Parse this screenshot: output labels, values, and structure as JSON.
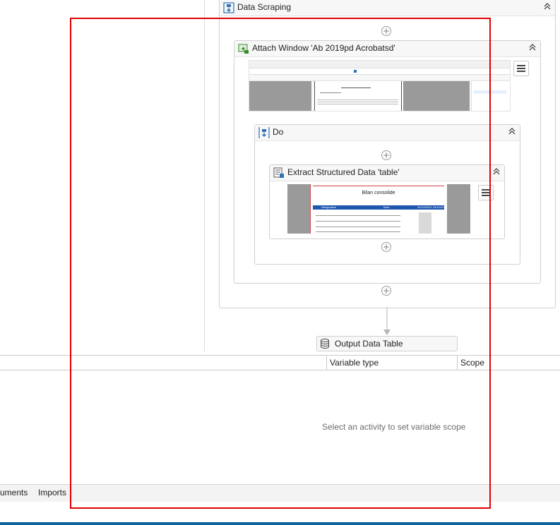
{
  "designer": {
    "data_scraping": {
      "title": "Data Scraping"
    },
    "attach_window": {
      "title": "Attach Window 'Ab 2019pd Acrobatsd'"
    },
    "do": {
      "title": "Do"
    },
    "extract": {
      "title": "Extract Structured Data 'table'",
      "preview_heading": "Bilan consolide",
      "preview_columns": [
        "Désignation",
        "Note",
        "31/12/2019",
        "31/12/2018"
      ]
    },
    "output": {
      "title": "Output Data Table"
    }
  },
  "variables_panel": {
    "columns": [
      "Variable type",
      "Scope"
    ],
    "empty_message": "Select an activity to set variable scope"
  },
  "bottom_tabs": [
    "uments",
    "Imports"
  ],
  "colors": {
    "accent": "#0e639c",
    "highlight": "#e00000",
    "preview_header": "#1e56b0"
  },
  "icons": [
    "scraping-icon",
    "attach-window-icon",
    "do-sequence-icon",
    "extract-data-icon",
    "database-icon",
    "collapse-icon",
    "menu-icon",
    "add-activity-icon"
  ]
}
